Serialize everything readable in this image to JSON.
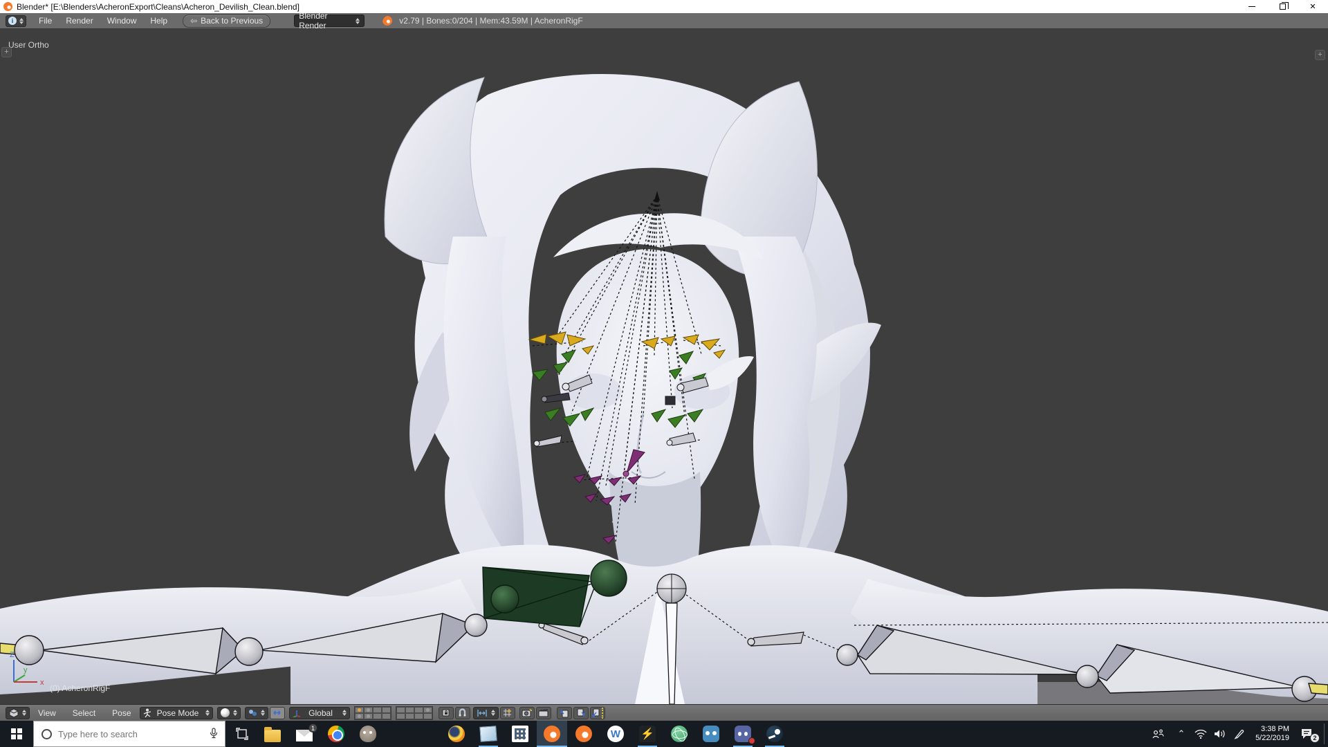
{
  "window": {
    "title": "Blender* [E:\\Blenders\\AcheronExport\\Cleans\\Acheron_Devilish_Clean.blend]",
    "controls": {
      "close_glyph": "✕"
    }
  },
  "menu_bar": {
    "menus": [
      "File",
      "Render",
      "Window",
      "Help"
    ],
    "back_button_label": "Back to Previous",
    "back_icon_glyph": "⇦",
    "engine_select_value": "Blender Render",
    "status": "v2.79 | Bones:0/204  | Mem:43.59M | AcheronRigF"
  },
  "viewport": {
    "view_label": "User Ortho",
    "object_label": "(0) AcheronRigF",
    "axis": {
      "x": "x",
      "y": "y",
      "z": "Z"
    },
    "corner_plus_glyph": "+"
  },
  "view_header": {
    "menus": [
      "View",
      "Select",
      "Pose"
    ],
    "mode_select_value": "Pose Mode",
    "orientation_select_value": "Global"
  },
  "taskbar": {
    "search_placeholder": "Type here to search",
    "mic_glyph": "🎙",
    "apps": [
      "task-view",
      "file-explorer",
      "mail",
      "chrome",
      "gimp",
      "firefox",
      "notepad",
      "calculator",
      "blender-active",
      "blender",
      "wallpaper-engine",
      "winamp",
      "atom",
      "godot",
      "discord",
      "steam"
    ],
    "wallpaper_engine_letter": "W",
    "winamp_glyph": "⚡",
    "mail_badge": "1",
    "tray": {
      "time": "3:38 PM",
      "date": "5/22/2019",
      "notification_badge": "2",
      "chevron_glyph": "⌃"
    }
  },
  "colors": {
    "blender_accent": "#f5792a",
    "taskbar_underline": "#76b9ed",
    "viewport_background": "#3e3e3e",
    "header_gray": "#6b6b6b",
    "bone_yellow": "#d9a91e",
    "bone_green": "#3a7d22",
    "bone_purple": "#7e2f73",
    "bone_dark_green": "#1d3a24",
    "layer_active_dot": "#e8a33d"
  }
}
